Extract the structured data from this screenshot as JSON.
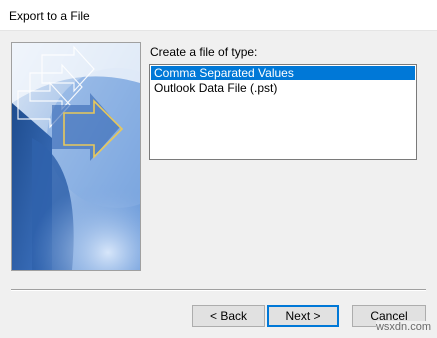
{
  "window": {
    "title": "Export to a File"
  },
  "main": {
    "type_label": "Create a file of type:",
    "file_types": [
      {
        "label": "Comma Separated Values",
        "selected": true
      },
      {
        "label": "Outlook Data File (.pst)",
        "selected": false
      }
    ]
  },
  "buttons": {
    "back": "< Back",
    "next": "Next >",
    "cancel": "Cancel"
  },
  "watermark": "wsxdn.com",
  "colors": {
    "selection": "#0078d7",
    "banner_dark": "#2a5a9e",
    "banner_light": "#a8c6ea",
    "arrow_outline": "#e8c85a"
  }
}
